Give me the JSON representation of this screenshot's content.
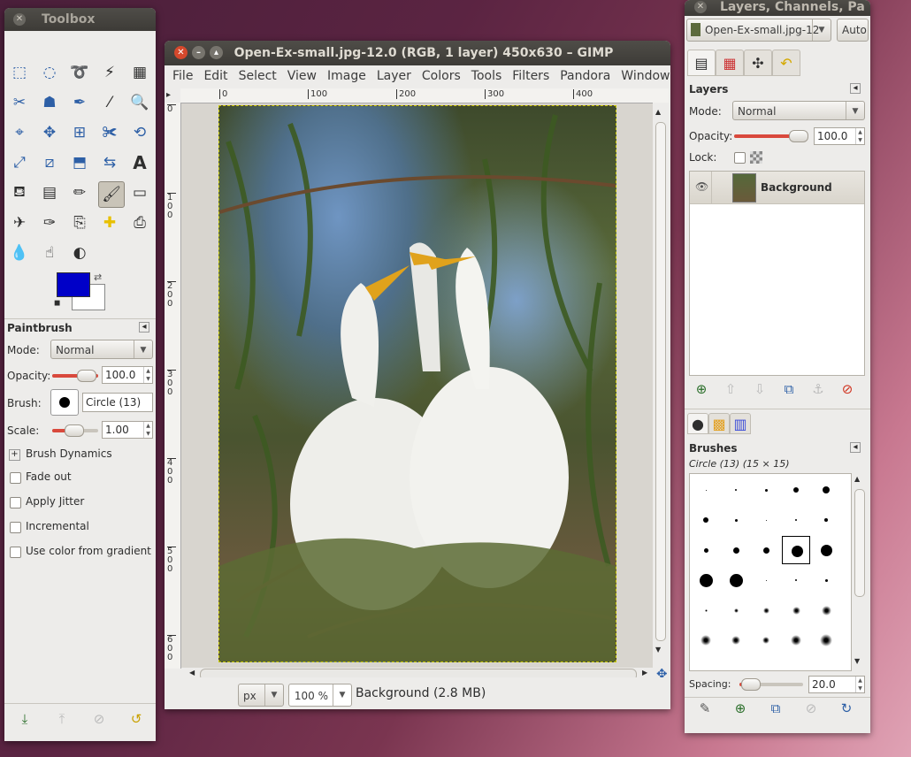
{
  "toolbox": {
    "title": "Toolbox",
    "tools": [
      "rect-select",
      "ellipse-select",
      "free-select",
      "fuzzy-select",
      "color-select",
      "scissors-select",
      "foreground-select",
      "paths",
      "color-picker",
      "zoom",
      "measure",
      "move",
      "align",
      "crop",
      "rotate",
      "scale",
      "shear",
      "perspective",
      "flip",
      "text",
      "bucket-fill",
      "blend",
      "pencil",
      "paintbrush",
      "eraser",
      "airbrush",
      "ink",
      "clone",
      "heal",
      "perspective-clone",
      "blur",
      "smudge",
      "dodge-burn"
    ],
    "fg_color": "#0000c8",
    "bg_color": "#ffffff",
    "options": {
      "title": "Paintbrush",
      "mode_label": "Mode:",
      "mode_value": "Normal",
      "opacity_label": "Opacity:",
      "opacity_value": "100.0",
      "brush_label": "Brush:",
      "brush_value": "Circle (13)",
      "scale_label": "Scale:",
      "scale_value": "1.00",
      "dynamics": "Brush Dynamics",
      "checks": [
        "Fade out",
        "Apply Jitter",
        "Incremental",
        "Use color from gradient"
      ]
    }
  },
  "image_window": {
    "title": "Open-Ex-small.jpg-12.0 (RGB, 1 layer) 450x630 – GIMP",
    "menu": [
      "File",
      "Edit",
      "Select",
      "View",
      "Image",
      "Layer",
      "Colors",
      "Tools",
      "Filters",
      "Pandora",
      "Windows",
      "Help"
    ],
    "ruler_h": [
      "0",
      "100",
      "200",
      "300",
      "400"
    ],
    "ruler_v": [
      "0",
      "100",
      "200",
      "300",
      "400",
      "500",
      "600"
    ],
    "unit": "px",
    "zoom": "100 %",
    "status": "Background (2.8 MB)"
  },
  "dock": {
    "title": "Layers, Channels, Pa",
    "image_select": "Open-Ex-small.jpg-12",
    "auto_label": "Auto",
    "layers": {
      "title": "Layers",
      "mode_label": "Mode:",
      "mode_value": "Normal",
      "opacity_label": "Opacity:",
      "opacity_value": "100.0",
      "lock_label": "Lock:",
      "layer_name": "Background"
    },
    "brushes": {
      "title": "Brushes",
      "current": "Circle (13) (15 × 15)",
      "spacing_label": "Spacing:",
      "spacing_value": "20.0"
    }
  }
}
